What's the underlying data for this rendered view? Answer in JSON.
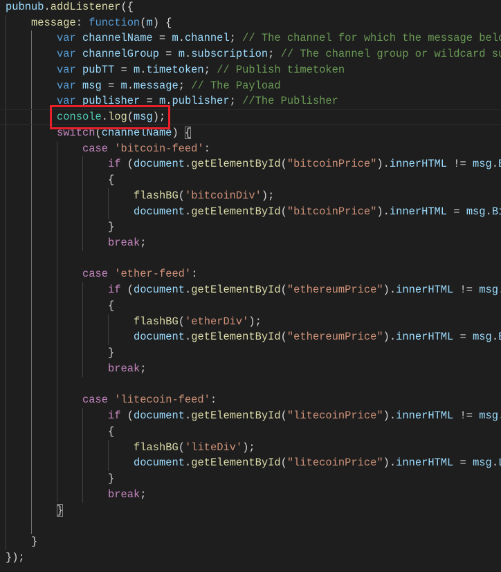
{
  "colors": {
    "background": "#1e1e1e",
    "keyword": "#569cd6",
    "control": "#c586c0",
    "variable": "#9cdcfe",
    "function": "#dcdcaa",
    "string": "#ce9178",
    "comment": "#6a9955",
    "class": "#4ec9b0",
    "highlight_box": "#e8202a"
  },
  "highlighted_line": 8,
  "lines": [
    {
      "indent": 0,
      "tokens": [
        [
          "v",
          "pubnub"
        ],
        [
          "d",
          "."
        ],
        [
          "f",
          "addListener"
        ],
        [
          "d",
          "({"
        ]
      ]
    },
    {
      "indent": 1,
      "tokens": [
        [
          "f",
          "message"
        ],
        [
          "d",
          ": "
        ],
        [
          "k",
          "function"
        ],
        [
          "d",
          "("
        ],
        [
          "v",
          "m"
        ],
        [
          "d",
          ") {"
        ]
      ]
    },
    {
      "indent": 2,
      "tokens": [
        [
          "k",
          "var "
        ],
        [
          "v",
          "channelName"
        ],
        [
          "d",
          " = "
        ],
        [
          "v",
          "m"
        ],
        [
          "d",
          "."
        ],
        [
          "v",
          "channel"
        ],
        [
          "d",
          "; "
        ],
        [
          "m",
          "// The channel for which the message belo"
        ]
      ]
    },
    {
      "indent": 2,
      "tokens": [
        [
          "k",
          "var "
        ],
        [
          "v",
          "channelGroup"
        ],
        [
          "d",
          " = "
        ],
        [
          "v",
          "m"
        ],
        [
          "d",
          "."
        ],
        [
          "v",
          "subscription"
        ],
        [
          "d",
          "; "
        ],
        [
          "m",
          "// The channel group or wildcard su"
        ]
      ]
    },
    {
      "indent": 2,
      "tokens": [
        [
          "k",
          "var "
        ],
        [
          "v",
          "pubTT"
        ],
        [
          "d",
          " = "
        ],
        [
          "v",
          "m"
        ],
        [
          "d",
          "."
        ],
        [
          "v",
          "timetoken"
        ],
        [
          "d",
          "; "
        ],
        [
          "m",
          "// Publish timetoken"
        ]
      ]
    },
    {
      "indent": 2,
      "tokens": [
        [
          "k",
          "var "
        ],
        [
          "v",
          "msg"
        ],
        [
          "d",
          " = "
        ],
        [
          "v",
          "m"
        ],
        [
          "d",
          "."
        ],
        [
          "v",
          "message"
        ],
        [
          "d",
          "; "
        ],
        [
          "m",
          "// The Payload"
        ]
      ]
    },
    {
      "indent": 2,
      "tokens": [
        [
          "k",
          "var "
        ],
        [
          "v",
          "publisher"
        ],
        [
          "d",
          " = "
        ],
        [
          "v",
          "m"
        ],
        [
          "d",
          "."
        ],
        [
          "v",
          "publisher"
        ],
        [
          "d",
          "; "
        ],
        [
          "m",
          "//The Publisher"
        ]
      ]
    },
    {
      "indent": 2,
      "tokens": [
        [
          "t",
          "console"
        ],
        [
          "d",
          "."
        ],
        [
          "f",
          "log"
        ],
        [
          "d",
          "("
        ],
        [
          "v",
          "msg"
        ],
        [
          "d",
          ");"
        ]
      ]
    },
    {
      "indent": 2,
      "tokens": [
        [
          "c",
          "switch"
        ],
        [
          "d",
          "("
        ],
        [
          "v",
          "channelName"
        ],
        [
          "d",
          ") "
        ],
        [
          "b",
          "{"
        ]
      ]
    },
    {
      "indent": 3,
      "tokens": [
        [
          "c",
          "case "
        ],
        [
          "s",
          "'bitcoin-feed'"
        ],
        [
          "d",
          ":"
        ]
      ]
    },
    {
      "indent": 4,
      "tokens": [
        [
          "c",
          "if "
        ],
        [
          "d",
          "("
        ],
        [
          "v",
          "document"
        ],
        [
          "d",
          "."
        ],
        [
          "f",
          "getElementById"
        ],
        [
          "d",
          "("
        ],
        [
          "s",
          "\"bitcoinPrice\""
        ],
        [
          "d",
          ")."
        ],
        [
          "v",
          "innerHTML"
        ],
        [
          "d",
          " != "
        ],
        [
          "v",
          "msg"
        ],
        [
          "d",
          "."
        ],
        [
          "v",
          "B"
        ]
      ]
    },
    {
      "indent": 4,
      "tokens": [
        [
          "d",
          "{"
        ]
      ]
    },
    {
      "indent": 5,
      "tokens": [
        [
          "f",
          "flashBG"
        ],
        [
          "d",
          "("
        ],
        [
          "s",
          "'bitcoinDiv'"
        ],
        [
          "d",
          ");"
        ]
      ]
    },
    {
      "indent": 5,
      "tokens": [
        [
          "v",
          "document"
        ],
        [
          "d",
          "."
        ],
        [
          "f",
          "getElementById"
        ],
        [
          "d",
          "("
        ],
        [
          "s",
          "\"bitcoinPrice\""
        ],
        [
          "d",
          ")."
        ],
        [
          "v",
          "innerHTML"
        ],
        [
          "d",
          " = "
        ],
        [
          "v",
          "msg"
        ],
        [
          "d",
          "."
        ],
        [
          "v",
          "Bi"
        ]
      ]
    },
    {
      "indent": 4,
      "tokens": [
        [
          "d",
          "}"
        ]
      ]
    },
    {
      "indent": 4,
      "tokens": [
        [
          "c",
          "break"
        ],
        [
          "d",
          ";"
        ]
      ]
    },
    {
      "indent": 3,
      "tokens": []
    },
    {
      "indent": 3,
      "tokens": [
        [
          "c",
          "case "
        ],
        [
          "s",
          "'ether-feed'"
        ],
        [
          "d",
          ":"
        ]
      ]
    },
    {
      "indent": 4,
      "tokens": [
        [
          "c",
          "if "
        ],
        [
          "d",
          "("
        ],
        [
          "v",
          "document"
        ],
        [
          "d",
          "."
        ],
        [
          "f",
          "getElementById"
        ],
        [
          "d",
          "("
        ],
        [
          "s",
          "\"ethereumPrice\""
        ],
        [
          "d",
          ")."
        ],
        [
          "v",
          "innerHTML"
        ],
        [
          "d",
          " != "
        ],
        [
          "v",
          "msg"
        ],
        [
          "d",
          "."
        ]
      ]
    },
    {
      "indent": 4,
      "tokens": [
        [
          "d",
          "{"
        ]
      ]
    },
    {
      "indent": 5,
      "tokens": [
        [
          "f",
          "flashBG"
        ],
        [
          "d",
          "("
        ],
        [
          "s",
          "'etherDiv'"
        ],
        [
          "d",
          ");"
        ]
      ]
    },
    {
      "indent": 5,
      "tokens": [
        [
          "v",
          "document"
        ],
        [
          "d",
          "."
        ],
        [
          "f",
          "getElementById"
        ],
        [
          "d",
          "("
        ],
        [
          "s",
          "\"ethereumPrice\""
        ],
        [
          "d",
          ")."
        ],
        [
          "v",
          "innerHTML"
        ],
        [
          "d",
          " = "
        ],
        [
          "v",
          "msg"
        ],
        [
          "d",
          "."
        ],
        [
          "v",
          "E"
        ]
      ]
    },
    {
      "indent": 4,
      "tokens": [
        [
          "d",
          "}"
        ]
      ]
    },
    {
      "indent": 4,
      "tokens": [
        [
          "c",
          "break"
        ],
        [
          "d",
          ";"
        ]
      ]
    },
    {
      "indent": 3,
      "tokens": []
    },
    {
      "indent": 3,
      "tokens": [
        [
          "c",
          "case "
        ],
        [
          "s",
          "'litecoin-feed'"
        ],
        [
          "d",
          ":"
        ]
      ]
    },
    {
      "indent": 4,
      "tokens": [
        [
          "c",
          "if "
        ],
        [
          "d",
          "("
        ],
        [
          "v",
          "document"
        ],
        [
          "d",
          "."
        ],
        [
          "f",
          "getElementById"
        ],
        [
          "d",
          "("
        ],
        [
          "s",
          "\"litecoinPrice\""
        ],
        [
          "d",
          ")."
        ],
        [
          "v",
          "innerHTML"
        ],
        [
          "d",
          " != "
        ],
        [
          "v",
          "msg"
        ],
        [
          "d",
          "."
        ]
      ]
    },
    {
      "indent": 4,
      "tokens": [
        [
          "d",
          "{"
        ]
      ]
    },
    {
      "indent": 5,
      "tokens": [
        [
          "f",
          "flashBG"
        ],
        [
          "d",
          "("
        ],
        [
          "s",
          "'liteDiv'"
        ],
        [
          "d",
          ");"
        ]
      ]
    },
    {
      "indent": 5,
      "tokens": [
        [
          "v",
          "document"
        ],
        [
          "d",
          "."
        ],
        [
          "f",
          "getElementById"
        ],
        [
          "d",
          "("
        ],
        [
          "s",
          "\"litecoinPrice\""
        ],
        [
          "d",
          ")."
        ],
        [
          "v",
          "innerHTML"
        ],
        [
          "d",
          " = "
        ],
        [
          "v",
          "msg"
        ],
        [
          "d",
          "."
        ],
        [
          "v",
          "L"
        ]
      ]
    },
    {
      "indent": 4,
      "tokens": [
        [
          "d",
          "}"
        ]
      ]
    },
    {
      "indent": 4,
      "tokens": [
        [
          "c",
          "break"
        ],
        [
          "d",
          ";"
        ]
      ]
    },
    {
      "indent": 2,
      "tokens": [
        [
          "b",
          "}"
        ]
      ]
    },
    {
      "indent": 2,
      "tokens": []
    },
    {
      "indent": 1,
      "tokens": [
        [
          "d",
          "}"
        ]
      ]
    },
    {
      "indent": 0,
      "tokens": [
        [
          "d",
          "});"
        ]
      ]
    }
  ]
}
